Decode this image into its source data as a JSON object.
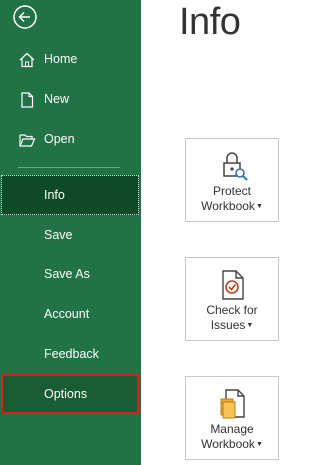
{
  "sidebar": {
    "back_icon": "back-arrow-icon",
    "items": [
      {
        "label": "Home",
        "icon": "home-icon"
      },
      {
        "label": "New",
        "icon": "new-document-icon"
      },
      {
        "label": "Open",
        "icon": "open-folder-icon"
      },
      {
        "label": "Info",
        "selected": true
      },
      {
        "label": "Save"
      },
      {
        "label": "Save As"
      },
      {
        "label": "Account"
      },
      {
        "label": "Feedback"
      },
      {
        "label": "Options",
        "highlighted": true
      }
    ]
  },
  "main": {
    "title": "Info",
    "tiles": [
      {
        "line1": "Protect",
        "line2": "Workbook",
        "icon": "lock-magnifier-icon"
      },
      {
        "line1": "Check for",
        "line2": "Issues",
        "icon": "document-check-icon"
      },
      {
        "line1": "Manage",
        "line2": "Workbook",
        "icon": "manage-workbook-icon"
      }
    ]
  },
  "colors": {
    "sidebar_bg": "#217346",
    "selected_bg": "#0e4a26",
    "highlight_border": "#e01b1b"
  }
}
